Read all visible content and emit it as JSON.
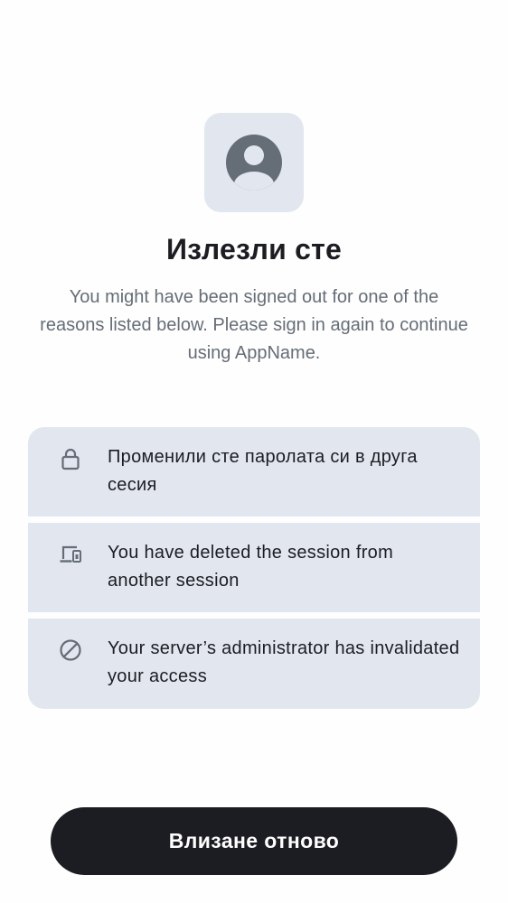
{
  "hero": {
    "icon": "user-profile-icon"
  },
  "title": "Излезли сте",
  "subtitle": "You might have been signed out for one of the reasons listed below. Please sign in again to continue using AppName.",
  "reasons": [
    {
      "icon": "lock-icon",
      "text": "Променили сте паролата си в друга сесия"
    },
    {
      "icon": "devices-icon",
      "text": "You have deleted the session from another session"
    },
    {
      "icon": "block-icon",
      "text": "Your server’s administrator has invalidated your access"
    }
  ],
  "button": {
    "label": "Влизане отново"
  },
  "colors": {
    "background": "#fefefe",
    "card": "#e2e6ee",
    "primary": "#1b1d22",
    "muted_text": "#656d77",
    "icon": "#656d77"
  }
}
